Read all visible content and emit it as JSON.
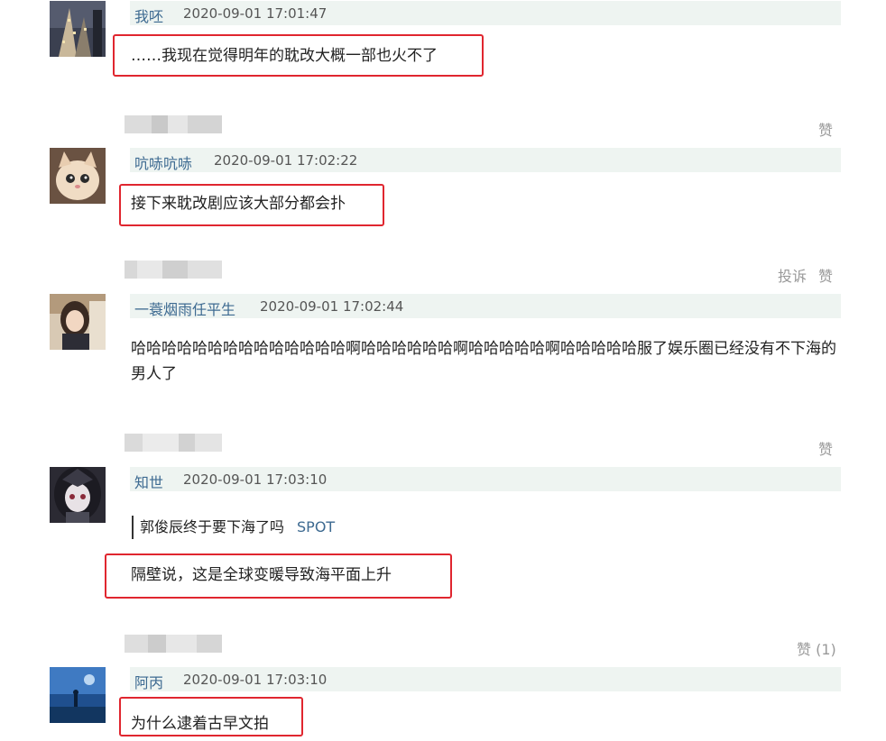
{
  "comments": [
    {
      "user": "我呸",
      "time": "2020-09-01 17:01:47",
      "text": "……我现在觉得明年的耽改大概一部也火不了"
    },
    {
      "user": "吭哧吭哧",
      "time": "2020-09-01 17:02:22",
      "text": "接下来耽改剧应该大部分都会扑"
    },
    {
      "user": "一蓑烟雨任平生",
      "time": "2020-09-01 17:02:44",
      "text": "哈哈哈哈哈哈哈哈哈哈哈哈哈哈啊哈哈哈哈哈哈啊哈哈哈哈哈啊哈哈哈哈哈服了娱乐圈已经没有不下海的男人了"
    },
    {
      "user": "知世",
      "time": "2020-09-01 17:03:10",
      "quote": "郭俊辰终于要下海了吗",
      "quote_tag": "SPOT",
      "text": "隔壁说，这是全球变暖导致海平面上升"
    },
    {
      "user": "阿丙",
      "time": "2020-09-01 17:03:10",
      "text": "为什么逮着古早文拍"
    }
  ],
  "actions": {
    "like": "赞",
    "report": "投诉",
    "like_count": "赞 (1)"
  },
  "colors": {
    "username": "#3d6a91",
    "meta_bar": "#eef4f1",
    "highlight_box": "#e0262f",
    "action_text": "#999999"
  }
}
